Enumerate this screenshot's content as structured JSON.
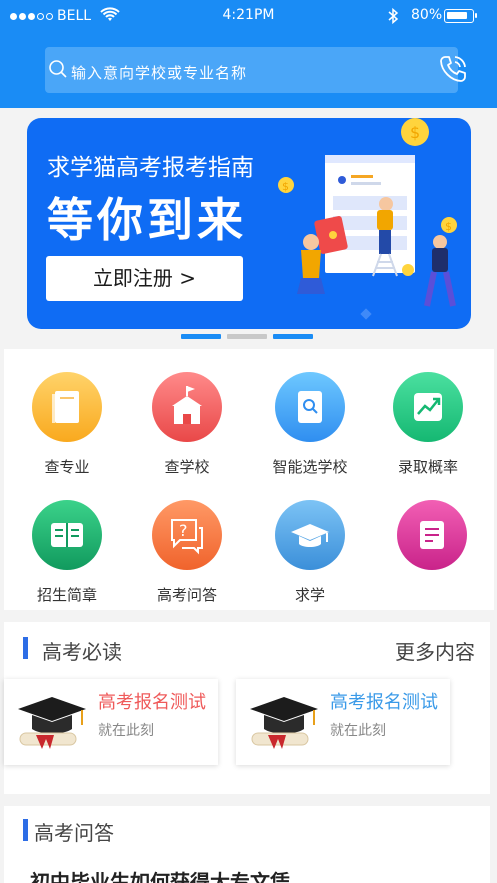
{
  "status_bar": {
    "carrier": "BELL",
    "time": "4:21PM",
    "battery": "80%",
    "battery_level": 0.8
  },
  "search": {
    "placeholder": "输入意向学校或专业名称",
    "search_icon": "search-icon",
    "contact_icon": "phone-call-icon"
  },
  "banner": {
    "line1": "求学猫高考报考指南",
    "line2": "等你到来",
    "button": "立即注册 >",
    "slide_count": 3,
    "active_slides": [
      1,
      3
    ]
  },
  "features": [
    {
      "label": "查专业",
      "icon": "book-icon",
      "color_from": "#ffd36a",
      "color_to": "#f9a91e"
    },
    {
      "label": "查学校",
      "icon": "school-icon",
      "color_from": "#ff8a8a",
      "color_to": "#e94848"
    },
    {
      "label": "智能选学校",
      "icon": "search-book-icon",
      "color_from": "#6ec8ff",
      "color_to": "#2f8ef0"
    },
    {
      "label": "录取概率",
      "icon": "trend-chart-icon",
      "color_from": "#4be0a0",
      "color_to": "#15b872"
    },
    {
      "label": "招生简章",
      "icon": "open-book-icon",
      "color_from": "#3bd28a",
      "color_to": "#119a5e"
    },
    {
      "label": "高考问答",
      "icon": "question-chat-icon",
      "color_from": "#ff9966",
      "color_to": "#f0632c"
    },
    {
      "label": "求学",
      "icon": "graduation-cap-icon",
      "color_from": "#7cc3f5",
      "color_to": "#3b8fd9"
    },
    {
      "label": "",
      "icon": "document-icon",
      "color_from": "#f25fb4",
      "color_to": "#c9238a"
    }
  ],
  "must_read": {
    "title": "高考必读",
    "more": "更多内容",
    "cards": [
      {
        "title": "高考报名测试",
        "subtitle": "就在此刻",
        "title_color": "#ef5a5a",
        "icon": "graduation-cap-diploma-icon"
      },
      {
        "title": "高考报名测试",
        "subtitle": "就在此刻",
        "title_color": "#3a9ae8",
        "icon": "graduation-cap-diploma-icon"
      }
    ]
  },
  "qa": {
    "title": "高考问答",
    "first_question": "初中毕业生如何获得大专文凭"
  },
  "colors": {
    "primary": "#1a8cf5",
    "accent_bar": "#2d6de6"
  }
}
